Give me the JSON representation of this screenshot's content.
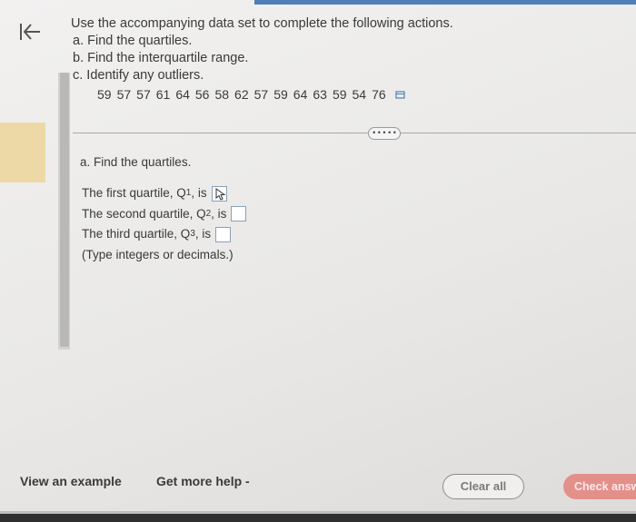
{
  "colors": {
    "accent": "#4f7fb8",
    "check_button": "#e4908a",
    "gutter_highlight": "#ecd9a6"
  },
  "question": {
    "intro": "Use the accompanying data set to complete the following actions.",
    "parts": [
      "a. Find the quartiles.",
      "b. Find the interquartile range.",
      "c. Identify any outliers."
    ]
  },
  "data_values": [
    "59",
    "57",
    "57",
    "61",
    "64",
    "56",
    "58",
    "62",
    "57",
    "59",
    "64",
    "63",
    "59",
    "54",
    "76"
  ],
  "expand_label": "• • • • •",
  "part_a": {
    "heading": "a. Find the quartiles.",
    "q1_label": "The first quartile, Q",
    "q1_sub": "1",
    "q2_label": "The second quartile, Q",
    "q2_sub": "2",
    "q3_label": "The third quartile, Q",
    "q3_sub": "3",
    "is_word": ", is",
    "note": "(Type integers or decimals.)"
  },
  "footer": {
    "view_example": "View an example",
    "get_more_help": "Get more help -",
    "clear_all": "Clear all",
    "check_answer": "Check answer"
  },
  "icons": {
    "back": "back-arrow-icon",
    "copy": "copy-icon",
    "cursor": "pointer-cursor-icon"
  }
}
